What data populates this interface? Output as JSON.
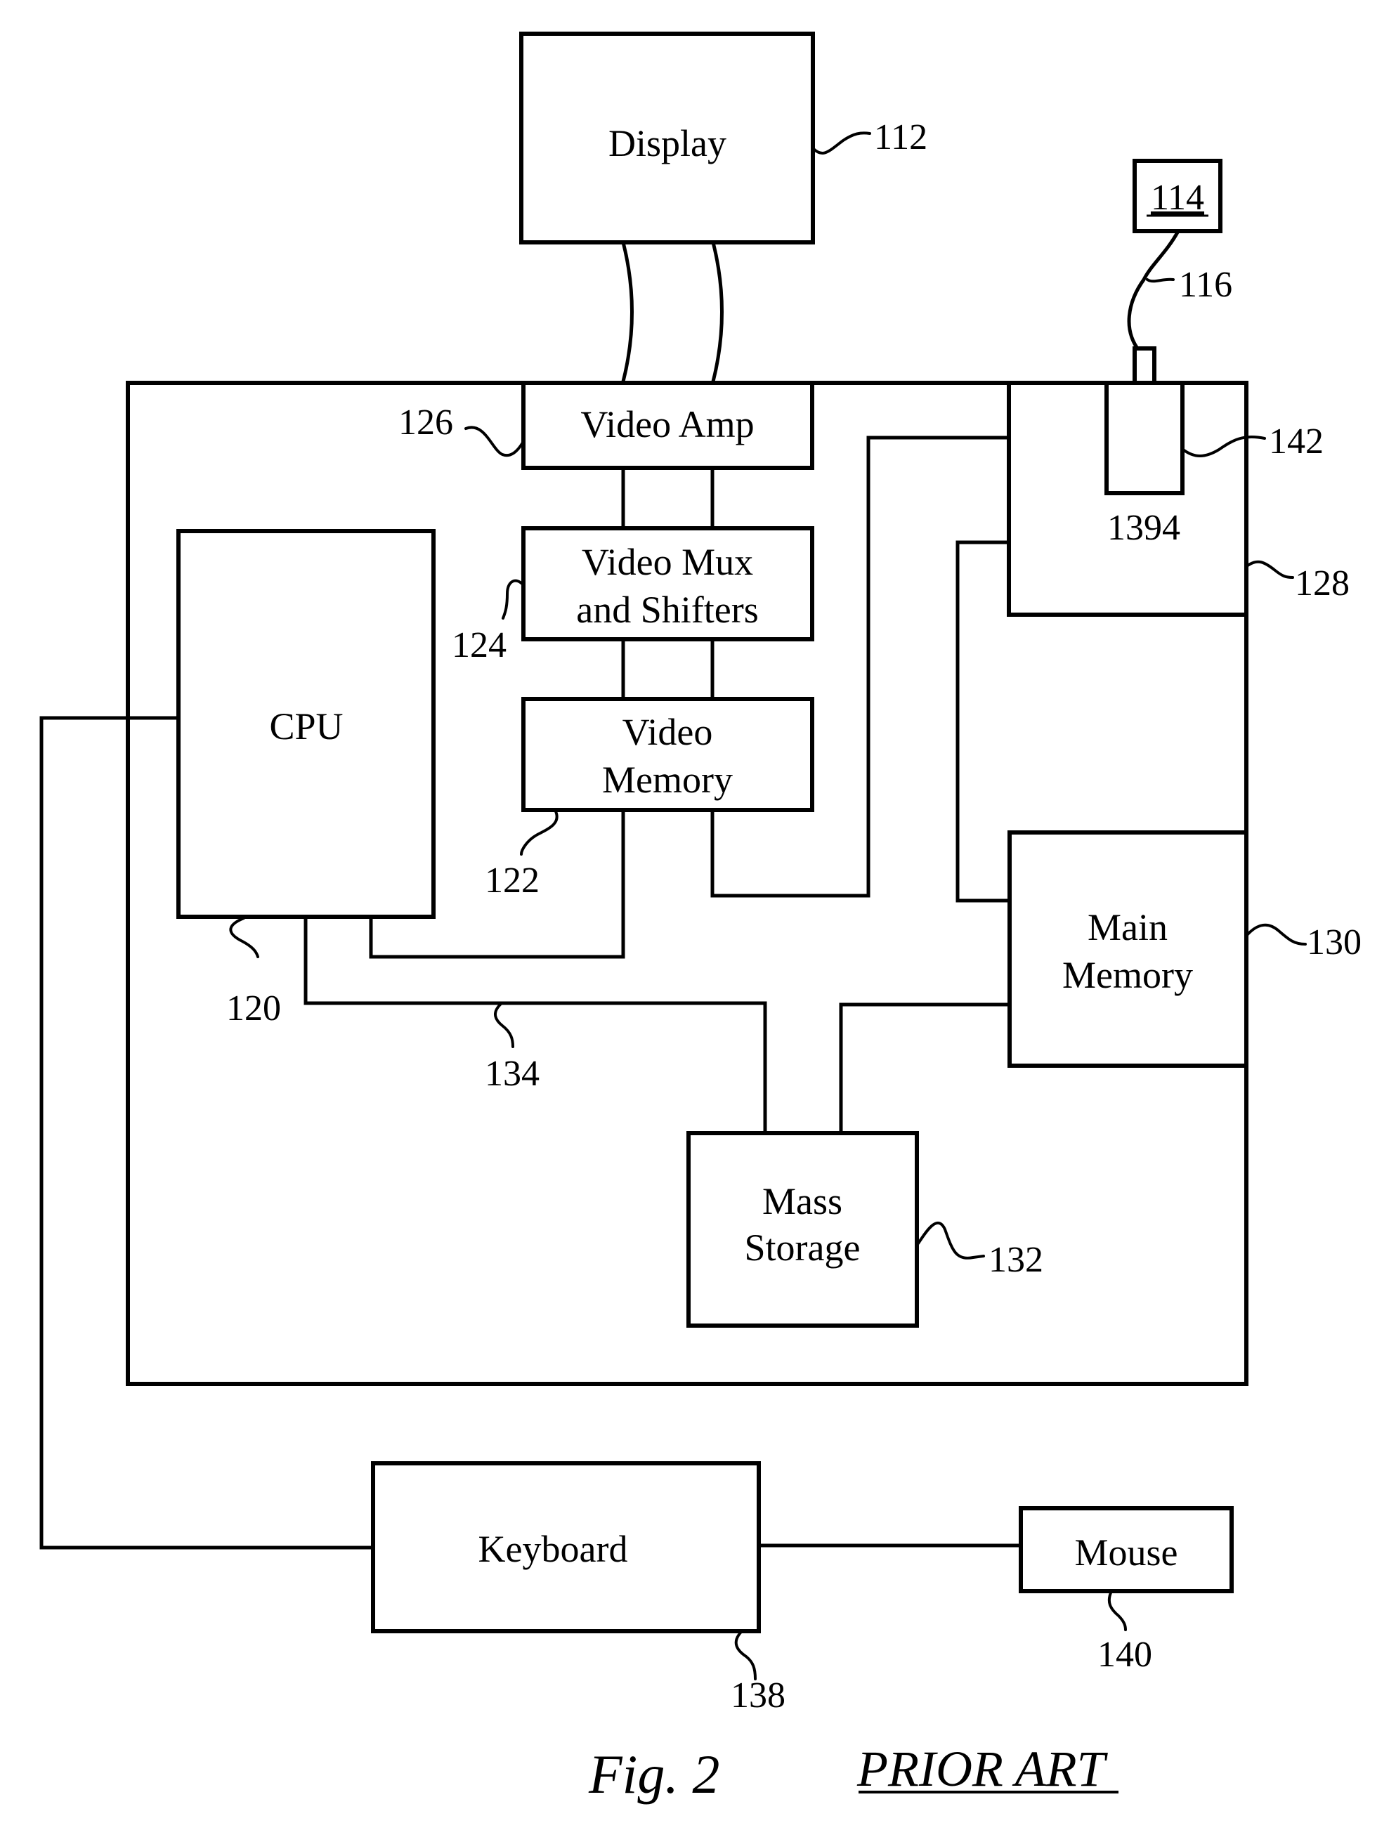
{
  "figure": {
    "title": "Fig. 2",
    "subtitle": "PRIOR ART"
  },
  "components": {
    "display": {
      "label": "Display",
      "ref": "112"
    },
    "device_114": {
      "ref": "114"
    },
    "cable_116": {
      "ref": "116"
    },
    "video_amp": {
      "label": "Video Amp",
      "ref": "126"
    },
    "video_mux": {
      "label_line1": "Video Mux",
      "label_line2": "and Shifters",
      "ref": "124"
    },
    "video_memory": {
      "label_line1": "Video",
      "label_line2": "Memory",
      "ref": "122"
    },
    "cpu": {
      "label": "CPU",
      "ref": "120"
    },
    "bus": {
      "ref": "134"
    },
    "io_board": {
      "ref": "128"
    },
    "port_1394": {
      "label": "1394",
      "ref": "142"
    },
    "main_memory": {
      "label_line1": "Main",
      "label_line2": "Memory",
      "ref": "130"
    },
    "mass_storage": {
      "label_line1": "Mass",
      "label_line2": "Storage",
      "ref": "132"
    },
    "keyboard": {
      "label": "Keyboard",
      "ref": "138"
    },
    "mouse": {
      "label": "Mouse",
      "ref": "140"
    }
  }
}
